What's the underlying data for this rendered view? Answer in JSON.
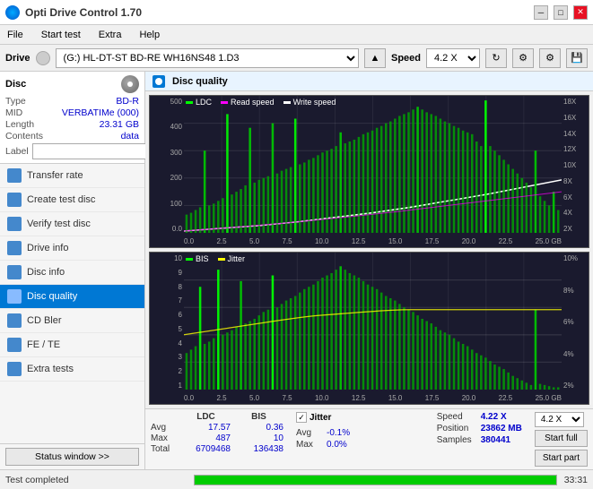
{
  "app": {
    "title": "Opti Drive Control 1.70",
    "icon": "disc-icon"
  },
  "titlebar": {
    "minimize": "─",
    "maximize": "□",
    "close": "✕"
  },
  "menu": {
    "items": [
      "File",
      "Start test",
      "Extra",
      "Help"
    ]
  },
  "drive_bar": {
    "drive_label": "Drive",
    "drive_value": "(G:)  HL-DT-ST BD-RE  WH16NS48 1.D3",
    "speed_label": "Speed",
    "speed_value": "4.2 X"
  },
  "disc": {
    "label": "Disc",
    "type_label": "Type",
    "type_value": "BD-R",
    "mid_label": "MID",
    "mid_value": "VERBATIMe (000)",
    "length_label": "Length",
    "length_value": "23.31 GB",
    "contents_label": "Contents",
    "contents_value": "data",
    "label_label": "Label",
    "label_value": ""
  },
  "nav": {
    "items": [
      {
        "id": "transfer-rate",
        "label": "Transfer rate",
        "icon": "chart-icon"
      },
      {
        "id": "create-test-disc",
        "label": "Create test disc",
        "icon": "disc-create-icon"
      },
      {
        "id": "verify-test-disc",
        "label": "Verify test disc",
        "icon": "verify-icon"
      },
      {
        "id": "drive-info",
        "label": "Drive info",
        "icon": "drive-icon"
      },
      {
        "id": "disc-info",
        "label": "Disc info",
        "icon": "disc-info-icon"
      },
      {
        "id": "disc-quality",
        "label": "Disc quality",
        "icon": "quality-icon",
        "active": true
      },
      {
        "id": "cd-bler",
        "label": "CD Bler",
        "icon": "bler-icon"
      },
      {
        "id": "fe-te",
        "label": "FE / TE",
        "icon": "fe-te-icon"
      },
      {
        "id": "extra-tests",
        "label": "Extra tests",
        "icon": "extra-icon"
      }
    ]
  },
  "chart_title": "Disc quality",
  "chart1": {
    "title": "LDC / Read speed / Write speed",
    "legend": [
      {
        "label": "LDC",
        "color": "#00ff00"
      },
      {
        "label": "Read speed",
        "color": "#ff00ff"
      },
      {
        "label": "Write speed",
        "color": "white"
      }
    ],
    "y_labels": [
      "500",
      "400",
      "300",
      "200",
      "100",
      "0.0"
    ],
    "y_labels_right": [
      "18X",
      "16X",
      "14X",
      "12X",
      "10X",
      "8X",
      "6X",
      "4X",
      "2X"
    ],
    "x_labels": [
      "0.0",
      "2.5",
      "5.0",
      "7.5",
      "10.0",
      "12.5",
      "15.0",
      "17.5",
      "20.0",
      "22.5",
      "25.0 GB"
    ]
  },
  "chart2": {
    "title": "BIS / Jitter",
    "legend": [
      {
        "label": "BIS",
        "color": "#00ff00"
      },
      {
        "label": "Jitter",
        "color": "#ffff00"
      }
    ],
    "y_labels": [
      "10",
      "9",
      "8",
      "7",
      "6",
      "5",
      "4",
      "3",
      "2",
      "1"
    ],
    "y_labels_right": [
      "10%",
      "8%",
      "6%",
      "4%",
      "2%"
    ],
    "x_labels": [
      "0.0",
      "2.5",
      "5.0",
      "7.5",
      "10.0",
      "12.5",
      "15.0",
      "17.5",
      "20.0",
      "22.5",
      "25.0 GB"
    ]
  },
  "stats": {
    "col_headers": [
      "",
      "LDC",
      "BIS",
      "",
      "Jitter",
      "Speed"
    ],
    "avg_label": "Avg",
    "avg_ldc": "17.57",
    "avg_bis": "0.36",
    "avg_jitter": "-0.1%",
    "max_label": "Max",
    "max_ldc": "487",
    "max_bis": "10",
    "max_jitter": "0.0%",
    "total_label": "Total",
    "total_ldc": "6709468",
    "total_bis": "136438",
    "speed_val": "4.22 X",
    "speed_dropdown": "4.2 X",
    "position_label": "Position",
    "position_value": "23862 MB",
    "samples_label": "Samples",
    "samples_value": "380441",
    "jitter_checked": true,
    "start_full_label": "Start full",
    "start_part_label": "Start part"
  },
  "bottom": {
    "status": "Test completed",
    "progress": 100,
    "time": "33:31"
  }
}
